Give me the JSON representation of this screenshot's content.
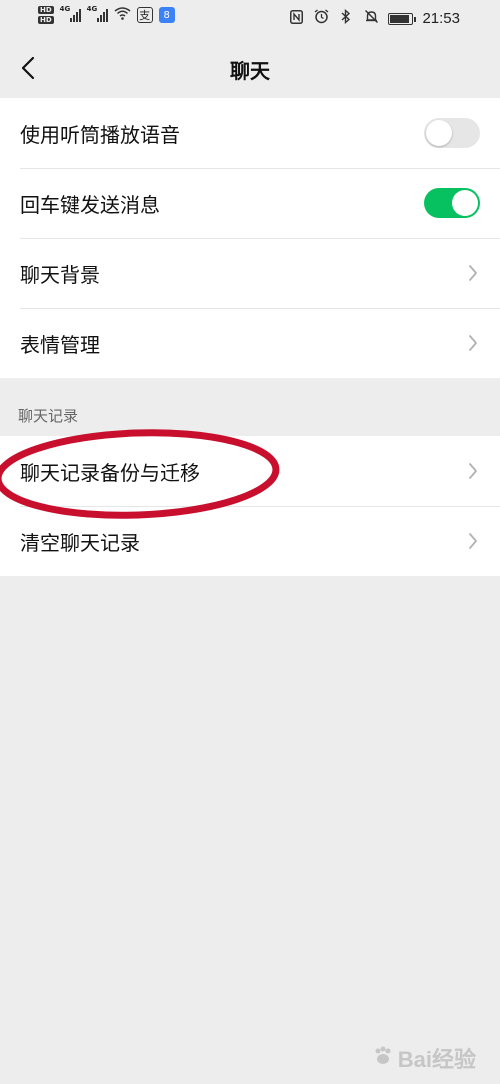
{
  "status_bar": {
    "hd_top": "HD",
    "hd_bottom": "HD",
    "network_1": "4G",
    "network_2": "4G",
    "alipay_glyph": "支",
    "app_glyph": "8",
    "time": "21:53",
    "icons": [
      "hd-icon",
      "signal-icon",
      "wifi-icon",
      "alipay-icon",
      "app-icon",
      "nfc-icon",
      "alarm-icon",
      "bluetooth-icon",
      "mute-icon",
      "battery-icon"
    ]
  },
  "nav": {
    "title": "聊天",
    "back_icon": "chevron-left-icon"
  },
  "settings_group_1": [
    {
      "label": "使用听筒播放语音",
      "control": "toggle",
      "on": false
    },
    {
      "label": "回车键发送消息",
      "control": "toggle",
      "on": true
    },
    {
      "label": "聊天背景",
      "control": "chevron"
    },
    {
      "label": "表情管理",
      "control": "chevron"
    }
  ],
  "section_chat_history": {
    "header": "聊天记录",
    "items": [
      {
        "label": "聊天记录备份与迁移",
        "control": "chevron",
        "highlighted": true
      },
      {
        "label": "清空聊天记录",
        "control": "chevron"
      }
    ]
  },
  "colors": {
    "background": "#ededed",
    "toggle_on": "#07c160",
    "toggle_off": "#e6e6e6",
    "highlight": "#c8102e"
  },
  "watermark": {
    "text": "Bai经验"
  }
}
